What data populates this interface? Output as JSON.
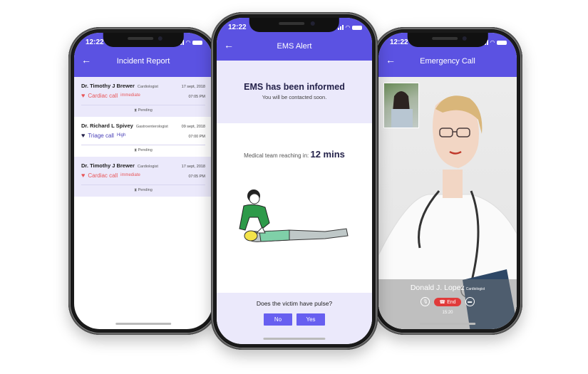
{
  "status": {
    "time": "12:22"
  },
  "colors": {
    "accent": "#5b52e2",
    "highlight": "#ebe9fb",
    "cardiac": "#e8575a",
    "triage": "#4a41b8",
    "button": "#675ff0",
    "end_call": "#e03b3b"
  },
  "incident_report": {
    "title": "Incident Report",
    "back_icon": "arrow-left-icon",
    "items": [
      {
        "doctor": "Dr. Timothy J Brewer",
        "specialty": "Cardiologist",
        "date": "17 sept, 2018",
        "time": "07:05 PM",
        "call_type": "Cardiac call",
        "priority": "immediate",
        "status": "Pending",
        "highlighted": true
      },
      {
        "doctor": "Dr. Richard L Spivey",
        "specialty": "Gastroenterologist",
        "date": "09 sept, 2018",
        "time": "07:00 PM",
        "call_type": "Triage call",
        "priority": "High",
        "status": "Pending",
        "highlighted": false
      },
      {
        "doctor": "Dr. Timothy J Brewer",
        "specialty": "Cardiologist",
        "date": "17 sept, 2018",
        "time": "07:05 PM",
        "call_type": "Cardiac call",
        "priority": "immediate",
        "status": "Pending",
        "highlighted": true
      }
    ]
  },
  "ems_alert": {
    "title": "EMS Alert",
    "headline": "EMS has been informed",
    "subtext": "You will be contacted soon.",
    "eta_label": "Medical team reaching in:",
    "eta_value": "12 mins",
    "question": "Does the victim have pulse?",
    "no_label": "No",
    "yes_label": "Yes"
  },
  "emergency_call": {
    "title": "Emergency Call",
    "callee_name": "Donald J. Lopez",
    "callee_specialty": "Cardiologist",
    "end_label": "End",
    "duration": "15:20"
  }
}
